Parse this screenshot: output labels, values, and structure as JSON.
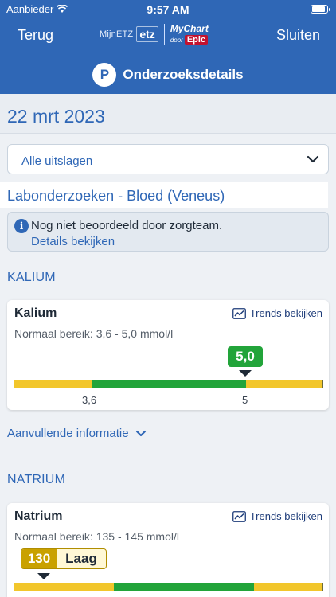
{
  "status_bar": {
    "carrier": "Aanbieder",
    "time": "9:57 AM"
  },
  "nav": {
    "back_label": "Terug",
    "close_label": "Sluiten",
    "logo_left": "MijnETZ",
    "logo_mid": "etz",
    "logo_mychart": "MyChart",
    "logo_door": "door",
    "logo_epic": "Epic"
  },
  "header": {
    "badge": "P",
    "title": "Onderzoeksdetails"
  },
  "date": "22 mrt 2023",
  "filter": {
    "selected": "Alle uitslagen"
  },
  "lab": {
    "title": "Labonderzoeken - Bloed (Veneus)"
  },
  "notice": {
    "text": "Nog niet beoordeeld door zorgteam.",
    "link": "Details bekijken"
  },
  "colors": {
    "accent": "#2f67b6",
    "normal": "#22a43a",
    "abnormal": "#f2c62b"
  },
  "results": [
    {
      "section": "KALIUM",
      "name": "Kalium",
      "trend_label": "Trends bekijken",
      "range_text": "Normaal bereik: 3,6 - 5,0 mmol/l",
      "value": "5,0",
      "flag": "",
      "low_label": "3,6",
      "high_label": "5"
    },
    {
      "section": "NATRIUM",
      "name": "Natrium",
      "trend_label": "Trends bekijken",
      "range_text": "Normaal bereik: 135 - 145 mmol/l",
      "value": "130",
      "flag": "Laag"
    }
  ],
  "more_info": "Aanvullende informatie"
}
